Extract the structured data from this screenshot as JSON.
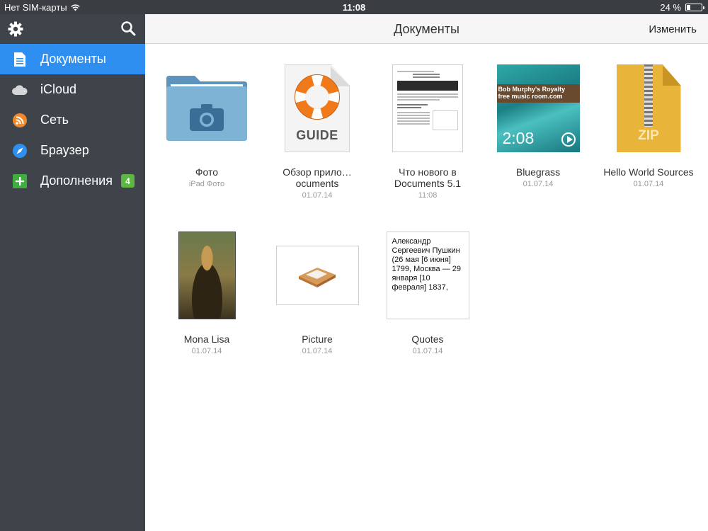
{
  "status_bar": {
    "carrier": "Нет SIM-карты",
    "time": "11:08",
    "battery": "24 %",
    "battery_level": 0.24
  },
  "sidebar": {
    "items": [
      {
        "label": "Документы",
        "icon": "document-icon",
        "active": true
      },
      {
        "label": "iCloud",
        "icon": "cloud-icon",
        "active": false
      },
      {
        "label": "Сеть",
        "icon": "network-icon",
        "active": false
      },
      {
        "label": "Браузер",
        "icon": "compass-icon",
        "active": false
      },
      {
        "label": "Дополнения",
        "icon": "plus-icon",
        "active": false,
        "badge": "4"
      }
    ]
  },
  "navbar": {
    "title": "Документы",
    "edit_label": "Изменить"
  },
  "files": [
    {
      "name": "Фото",
      "sub": "iPad Фото",
      "kind": "folder"
    },
    {
      "name": "Обзор прило…ocuments",
      "sub": "01.07.14",
      "kind": "guide",
      "thumb_label": "GUIDE"
    },
    {
      "name": "Что нового в Documents 5.1",
      "sub": "11:08",
      "kind": "document"
    },
    {
      "name": "Bluegrass",
      "sub": "01.07.14",
      "kind": "video",
      "duration": "2:08",
      "thumb_banner": "Bob Murphy's Royalty free music room.com"
    },
    {
      "name": "Hello World Sources",
      "sub": "01.07.14",
      "kind": "zip",
      "thumb_label": "ZIP"
    },
    {
      "name": "Mona Lisa",
      "sub": "01.07.14",
      "kind": "image"
    },
    {
      "name": "Picture",
      "sub": "01.07.14",
      "kind": "image"
    },
    {
      "name": "Quotes",
      "sub": "01.07.14",
      "kind": "text",
      "preview": "Александр Сергеевич Пушкин (26 мая [6 июня] 1799, Москва — 29 января [10 февраля] 1837,"
    }
  ],
  "colors": {
    "sidebar_bg": "#3f434a",
    "active_item": "#2f8ff0",
    "badge": "#5cb842",
    "folder": "#7fb3d6"
  }
}
